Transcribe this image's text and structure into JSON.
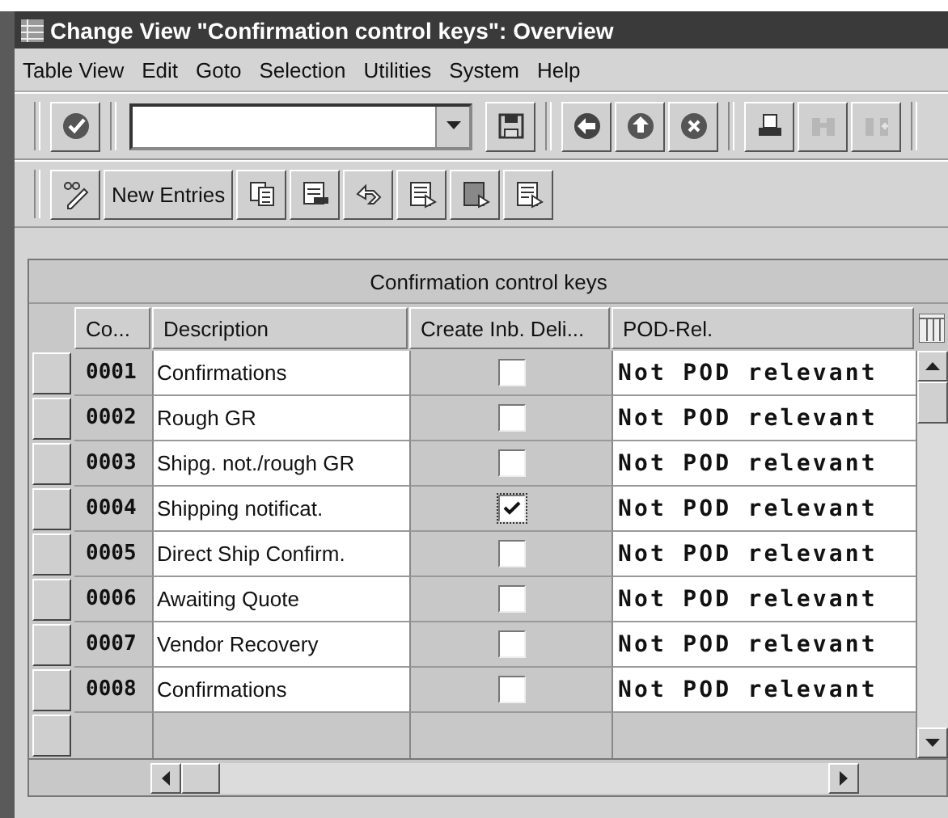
{
  "window": {
    "title": "Change View \"Confirmation control keys\": Overview"
  },
  "menu": [
    "Table View",
    "Edit",
    "Goto",
    "Selection",
    "Utilities",
    "System",
    "Help"
  ],
  "toolbar": {
    "buttons": [
      {
        "kind": "enter",
        "disabled": false
      },
      {
        "kind": "save",
        "disabled": false
      },
      {
        "kind": "back",
        "disabled": false
      },
      {
        "kind": "exit",
        "disabled": false
      },
      {
        "kind": "cancel",
        "disabled": false
      },
      {
        "kind": "print",
        "disabled": false
      },
      {
        "kind": "find",
        "disabled": true
      },
      {
        "kind": "find-next",
        "disabled": true
      }
    ]
  },
  "app_toolbar": [
    {
      "kind": "display-change"
    },
    {
      "kind": "text",
      "label": "New Entries"
    },
    {
      "kind": "copy"
    },
    {
      "kind": "delete"
    },
    {
      "kind": "undo"
    },
    {
      "kind": "select-all"
    },
    {
      "kind": "select-block"
    },
    {
      "kind": "deselect"
    }
  ],
  "table": {
    "title": "Confirmation control keys",
    "columns": [
      "Co...",
      "Description",
      "Create Inb. Deli...",
      "POD-Rel."
    ],
    "rows": [
      {
        "code": "0001",
        "description": "Confirmations",
        "create_inbound": false,
        "pod": "Not POD relevant"
      },
      {
        "code": "0002",
        "description": "Rough GR",
        "create_inbound": false,
        "pod": "Not POD relevant"
      },
      {
        "code": "0003",
        "description": "Shipg. not./rough GR",
        "create_inbound": false,
        "pod": "Not POD relevant"
      },
      {
        "code": "0004",
        "description": "Shipping notificat.",
        "create_inbound": true,
        "pod": "Not POD relevant"
      },
      {
        "code": "0005",
        "description": "Direct Ship Confirm.",
        "create_inbound": false,
        "pod": "Not POD relevant"
      },
      {
        "code": "0006",
        "description": "Awaiting Quote",
        "create_inbound": false,
        "pod": "Not POD relevant"
      },
      {
        "code": "0007",
        "description": "Vendor Recovery",
        "create_inbound": false,
        "pod": "Not POD relevant"
      },
      {
        "code": "0008",
        "description": "Confirmations",
        "create_inbound": false,
        "pod": "Not POD relevant"
      }
    ]
  }
}
